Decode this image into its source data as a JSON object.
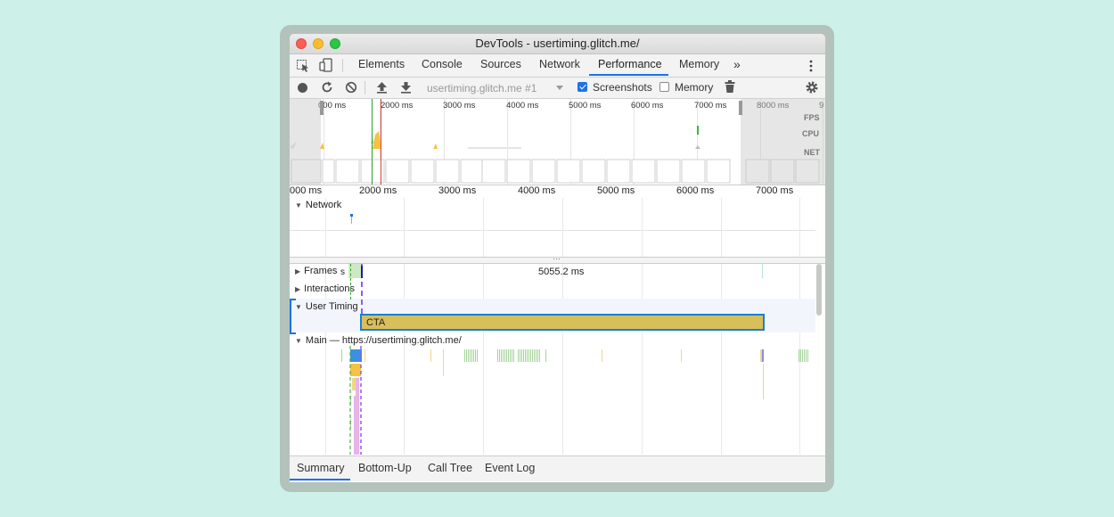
{
  "window": {
    "title": "DevTools - usertiming.glitch.me/"
  },
  "tabs": {
    "items": [
      "Elements",
      "Console",
      "Sources",
      "Network",
      "Performance",
      "Memory"
    ],
    "active": "Performance",
    "more_label": "»"
  },
  "toolbar": {
    "profile_select": "usertiming.glitch.me #1",
    "screenshots_label": "Screenshots",
    "screenshots_checked": true,
    "memory_label": "Memory",
    "memory_checked": false
  },
  "overview": {
    "ticks": [
      "000 ms",
      "2000 ms",
      "3000 ms",
      "4000 ms",
      "5000 ms",
      "6000 ms",
      "7000 ms",
      "8000 ms",
      "9"
    ],
    "side_labels": [
      "FPS",
      "CPU",
      "NET"
    ]
  },
  "ruler": {
    "ticks": [
      "000 ms",
      "2000 ms",
      "3000 ms",
      "4000 ms",
      "5000 ms",
      "6000 ms",
      "7000 ms"
    ]
  },
  "tracks": {
    "network": "Network",
    "frames": "Frames",
    "frames_suffix": "s",
    "frame_duration": "5055.2 ms",
    "interactions": "Interactions",
    "user_timing": "User Timing",
    "cta": "CTA",
    "main": "Main — https://usertiming.glitch.me/"
  },
  "bottom_tabs": [
    "Summary",
    "Bottom-Up",
    "Call Tree",
    "Event Log"
  ],
  "colors": {
    "accent": "#1a73e8",
    "cta_fill": "#d9bf5a",
    "cta_border": "#1a7fd6"
  }
}
